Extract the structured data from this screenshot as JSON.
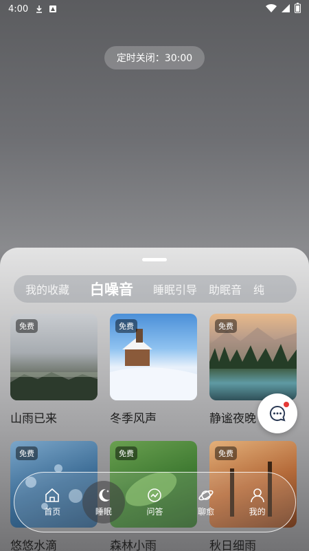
{
  "status_bar": {
    "time": "4:00"
  },
  "timer": {
    "label": "定时关闭：30:00"
  },
  "tabs": [
    {
      "label": "我的收藏"
    },
    {
      "label": "白噪音"
    },
    {
      "label": "睡眠引导"
    },
    {
      "label": "助眠音"
    },
    {
      "label": "纯"
    }
  ],
  "cards": [
    {
      "title": "山雨已来",
      "badge": "免费"
    },
    {
      "title": "冬季风声",
      "badge": "免费"
    },
    {
      "title": "静谧夜晚",
      "badge": "免费"
    },
    {
      "title": "悠悠水滴",
      "badge": "免费"
    },
    {
      "title": "森林小雨",
      "badge": "免费"
    },
    {
      "title": "秋日细雨",
      "badge": "免费"
    }
  ],
  "nav": [
    {
      "label": "首页",
      "icon": "home-icon"
    },
    {
      "label": "睡眠",
      "icon": "moon-icon"
    },
    {
      "label": "问答",
      "icon": "qa-icon"
    },
    {
      "label": "聊愈",
      "icon": "planet-icon"
    },
    {
      "label": "我的",
      "icon": "profile-icon"
    }
  ]
}
